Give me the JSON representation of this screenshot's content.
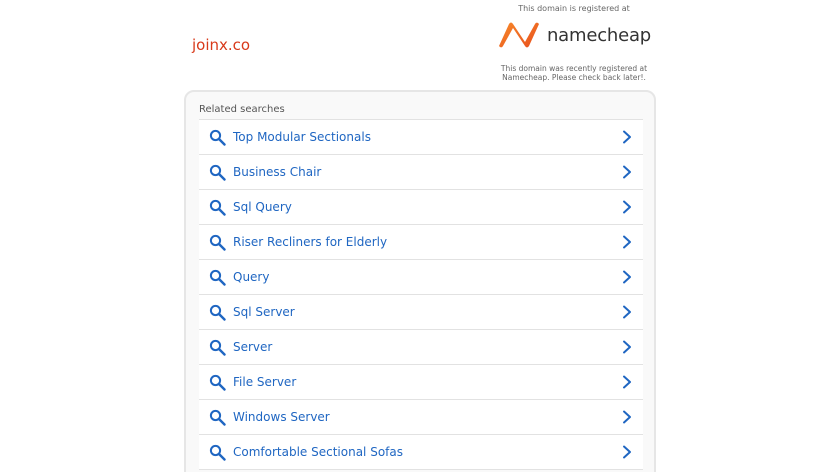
{
  "domain": "joinx.co",
  "registrar": {
    "registered_at": "This domain is registered at",
    "name": "namecheap",
    "note": "This domain was recently registered at Namecheap. Please check back later!.",
    "logo_color": "#f26b2a"
  },
  "related": {
    "title": "Related searches",
    "items": [
      {
        "label": "Top Modular Sectionals"
      },
      {
        "label": "Business Chair"
      },
      {
        "label": "Sql Query"
      },
      {
        "label": "Riser Recliners for Elderly"
      },
      {
        "label": "Query"
      },
      {
        "label": "Sql Server"
      },
      {
        "label": "Server"
      },
      {
        "label": "File Server"
      },
      {
        "label": "Windows Server"
      },
      {
        "label": "Comfortable Sectional Sofas"
      }
    ]
  },
  "colors": {
    "link": "#1f66c2",
    "domain": "#d8391a"
  },
  "icons": {
    "search": "search-icon",
    "chevron": "chevron-right-icon"
  }
}
